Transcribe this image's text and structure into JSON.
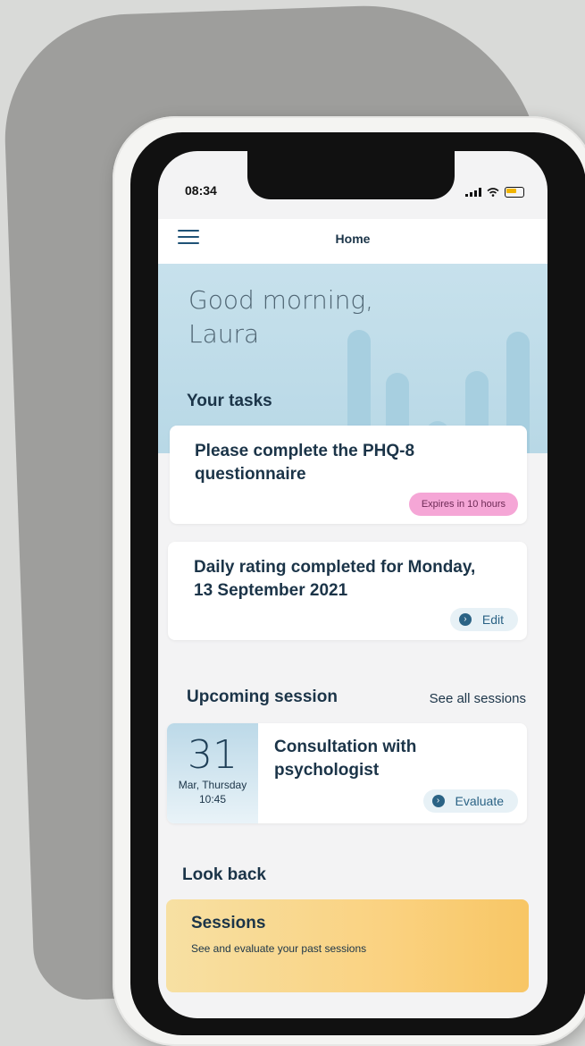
{
  "status_bar": {
    "time": "08:34"
  },
  "header": {
    "title": "Home"
  },
  "greeting": {
    "line1": "Good morning,",
    "line2": "Laura"
  },
  "tasks": {
    "title": "Your tasks",
    "items": [
      {
        "title_line1": "Please complete the PHQ-8",
        "title_line2": "questionnaire",
        "badge": "Expires in 10 hours"
      },
      {
        "title_line1": "Daily rating completed for Monday,",
        "title_line2": "13 September 2021",
        "action": "Edit"
      }
    ]
  },
  "upcoming": {
    "title": "Upcoming session",
    "see_all": "See all sessions",
    "session": {
      "day": "31",
      "date_text": "Mar, Thursday",
      "time": "10:45",
      "title_line1": "Consultation with",
      "title_line2": "psychologist",
      "action": "Evaluate"
    }
  },
  "look_back": {
    "title": "Look back",
    "card_title": "Sessions",
    "card_subtitle": "See and evaluate your past sessions"
  },
  "colors": {
    "primary_text": "#1b3448",
    "accent_blue": "#2b6385",
    "badge_pink": "#f5a6d6",
    "hero_blue": "#c7e1ec",
    "sessions_gold": "#fad281"
  }
}
